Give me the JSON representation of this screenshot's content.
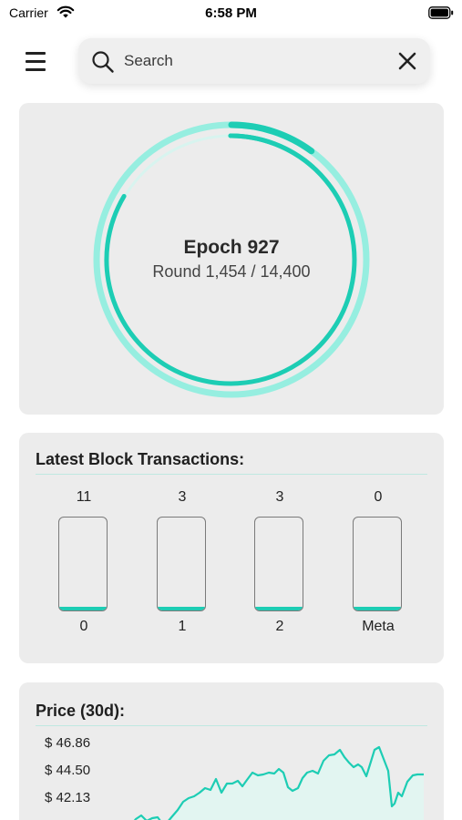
{
  "status_bar": {
    "carrier": "Carrier",
    "time": "6:58 PM"
  },
  "search": {
    "placeholder": "Search",
    "value": ""
  },
  "epoch": {
    "title": "Epoch 927",
    "round_label": "Round 1,454 / 14,400",
    "round_current": 1454,
    "round_total": 14400
  },
  "transactions": {
    "title": "Latest Block Transactions:",
    "columns": [
      {
        "count": "11",
        "label": "0"
      },
      {
        "count": "3",
        "label": "1"
      },
      {
        "count": "3",
        "label": "2"
      },
      {
        "count": "0",
        "label": "Meta"
      }
    ]
  },
  "price": {
    "title": "Price (30d):",
    "y_labels": [
      "$ 46.86",
      "$ 44.50",
      "$ 42.13"
    ]
  },
  "colors": {
    "accent": "#1dcdb4",
    "accent_light": "#96eee0",
    "card_bg": "#ececec"
  }
}
